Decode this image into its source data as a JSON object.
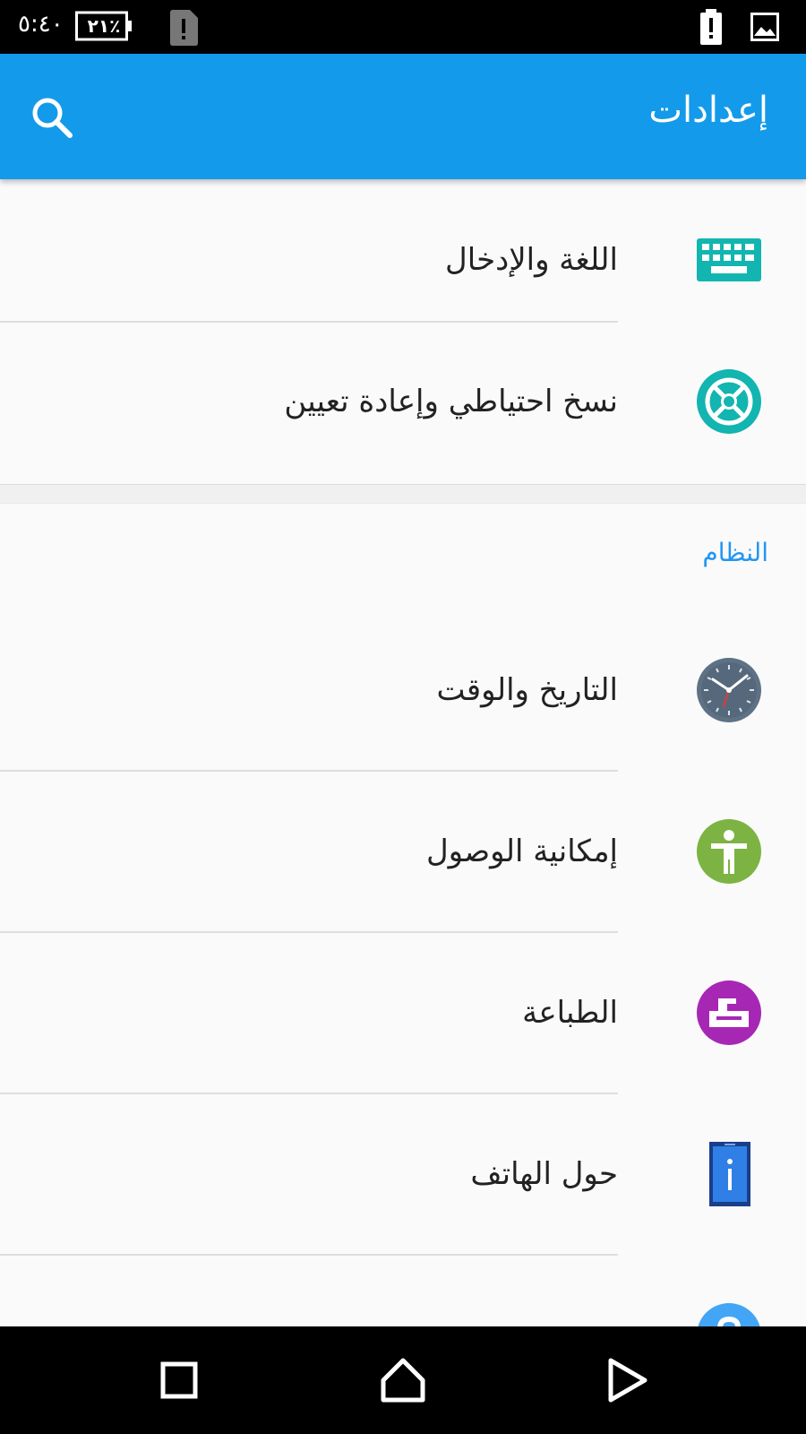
{
  "status_bar": {
    "time": "٥:٤٠",
    "battery_level": "٢١٪",
    "icons": [
      "battery-icon",
      "sim-alert-icon",
      "alert-icon",
      "image-notification-icon"
    ]
  },
  "app_bar": {
    "title": "إعدادات",
    "search_icon": "search-icon"
  },
  "colors": {
    "app_bar": "#149aea",
    "section_title": "#2196f3",
    "background": "#fafafa"
  },
  "settings": {
    "language_input": {
      "label": "اللغة والإدخال",
      "icon": "keyboard-icon"
    },
    "backup_reset": {
      "label": "نسخ احتياطي وإعادة تعيين",
      "icon": "backup-icon"
    },
    "section_system": "النظام",
    "date_time": {
      "label": "التاريخ والوقت",
      "icon": "clock-icon"
    },
    "accessibility": {
      "label": "إمكانية الوصول",
      "icon": "accessibility-icon"
    },
    "printing": {
      "label": "الطباعة",
      "icon": "print-icon"
    },
    "about_phone": {
      "label": "حول الهاتف",
      "icon": "phone-info-icon"
    },
    "help_icon": "help-icon"
  },
  "nav_bar": {
    "buttons": [
      "recents-button",
      "home-button",
      "back-button"
    ]
  }
}
